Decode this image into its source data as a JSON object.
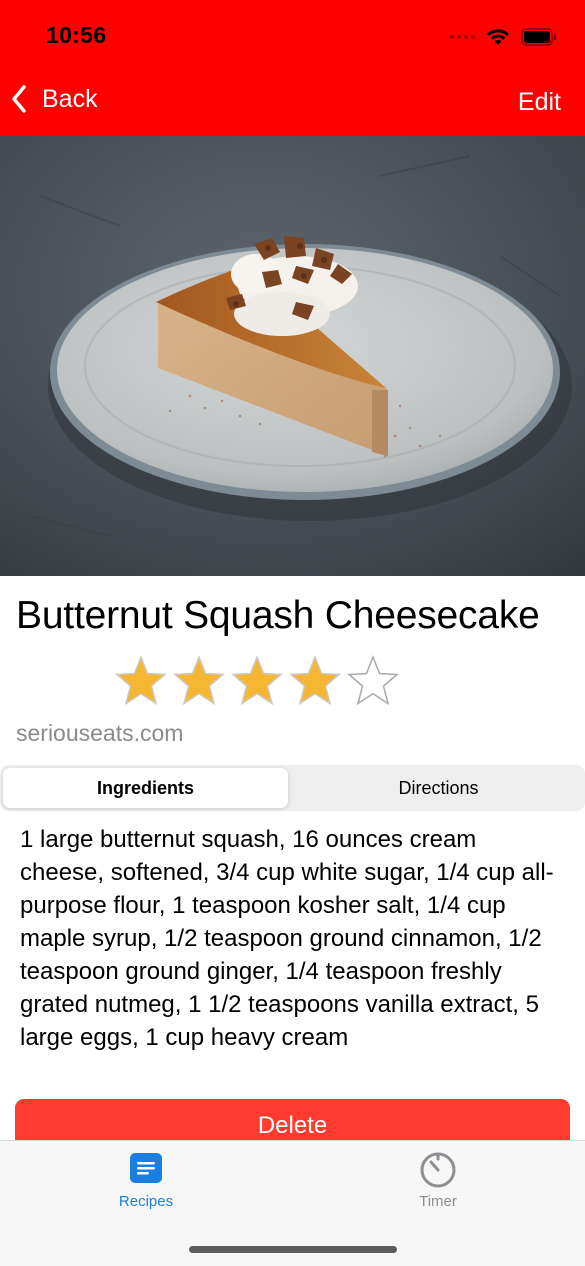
{
  "status": {
    "time": "10:56"
  },
  "nav": {
    "back_label": "Back",
    "edit_label": "Edit"
  },
  "recipe": {
    "title": "Butternut Squash Cheesecake",
    "rating": 4,
    "rating_max": 5,
    "source": "seriouseats.com",
    "ingredients": "1 large butternut squash, 16 ounces cream cheese, softened, 3/4 cup white sugar, 1/4 cup all-purpose flour, 1 teaspoon kosher salt, 1/4 cup maple syrup, 1/2 teaspoon ground cinnamon, 1/2 teaspoon ground ginger, 1/4 teaspoon freshly grated nutmeg, 1 1/2 teaspoons vanilla extract, 5 large eggs, 1 cup heavy cream"
  },
  "segments": {
    "ingredients_label": "Ingredients",
    "directions_label": "Directions",
    "selected": "Ingredients"
  },
  "actions": {
    "delete_label": "Delete"
  },
  "tabbar": {
    "recipes_label": "Recipes",
    "timer_label": "Timer",
    "selected": "Recipes"
  },
  "colors": {
    "nav_bar": "#ff0000",
    "delete": "#ff3b30",
    "tab_active": "#1a7fe0",
    "tab_inactive": "#8e8e93",
    "star": "#f5b731",
    "source_text": "#8a8a8e"
  }
}
